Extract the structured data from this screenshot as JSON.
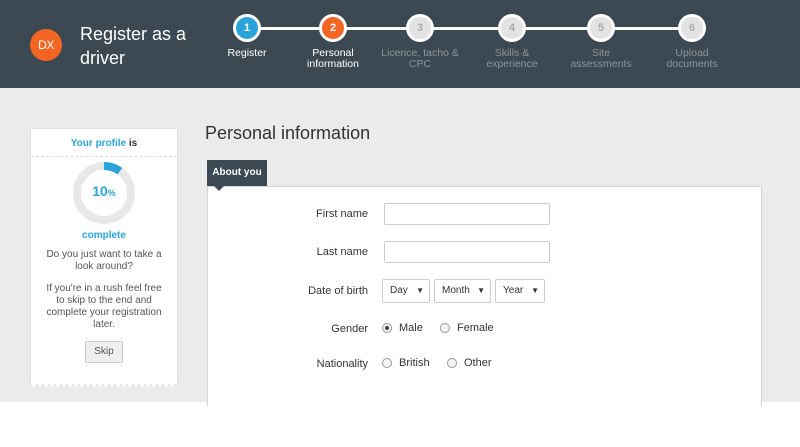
{
  "brand": {
    "logo_text": "DX",
    "title": "Register as a driver"
  },
  "steps": [
    {
      "number": "1",
      "label": "Register",
      "state": "done"
    },
    {
      "number": "2",
      "label": "Personal information",
      "state": "current"
    },
    {
      "number": "3",
      "label": "Licence, tacho & CPC",
      "state": "todo"
    },
    {
      "number": "4",
      "label": "Skills & experience",
      "state": "todo"
    },
    {
      "number": "5",
      "label": "Site assessments",
      "state": "todo"
    },
    {
      "number": "6",
      "label": "Upload documents",
      "state": "todo"
    }
  ],
  "profile": {
    "title_highlight": "Your profile",
    "title_rest": " is",
    "percent_value": "10",
    "percent_unit": "%",
    "progress": 0.1,
    "complete_label": "complete",
    "text1": "Do you just want to take a look around?",
    "text2": "If you're in a rush feel free to skip to the end and complete your registration later.",
    "skip_label": "Skip"
  },
  "main": {
    "page_title": "Personal information",
    "tab_label": "About you"
  },
  "form": {
    "first_name_label": "First name",
    "first_name_value": "",
    "last_name_label": "Last name",
    "last_name_value": "",
    "dob_label": "Date of birth",
    "day": "Day",
    "month": "Month",
    "year": "Year",
    "gender_label": "Gender",
    "gender_options": [
      "Male",
      "Female"
    ],
    "gender_selected": "Male",
    "nationality_label": "Nationality",
    "nationality_options": [
      "British",
      "Other"
    ]
  },
  "colors": {
    "header_bg": "#3d4952",
    "accent_blue": "#2aa3d9",
    "accent_orange": "#f26522",
    "band_bg": "#ebebeb"
  }
}
